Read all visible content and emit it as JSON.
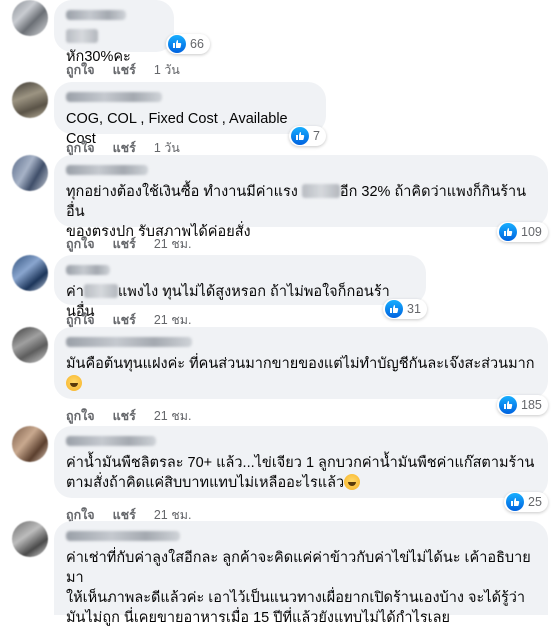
{
  "comments": [
    {
      "text_after_censor": "หัก30%คะ",
      "reactions": "66",
      "actions": {
        "like": "ถูกใจ",
        "reply": "แชร์",
        "time": "1 วัน"
      }
    },
    {
      "text": "COG, COL , Fixed Cost , Available Cost",
      "reactions": "7",
      "actions": {
        "like": "ถูกใจ",
        "reply": "แชร์",
        "time": "1 วัน"
      }
    },
    {
      "text_before_censor": "ทุกอย่างต้องใช้เงินซื้อ ทำงานมีค่าแรง ",
      "text_after_censor": "อีก 32% ถ้าคิดว่าแพงก็กินร้านอื่น",
      "text_line2": "ของตรงปก รับสภาพได้ค่อยสั่ง",
      "reactions": "109",
      "actions": {
        "like": "ถูกใจ",
        "reply": "แชร์",
        "time": "21 ชม."
      }
    },
    {
      "text_before_censor": "ค่า",
      "text_after_censor": "แพงไง ทุนไม่ได้สูงหรอก ถ้าไม่พอใจก็กอนร้านอื่น",
      "reactions": "31",
      "actions": {
        "like": "ถูกใจ",
        "reply": "แชร์",
        "time": "21 ชม."
      }
    },
    {
      "text": "มันคือต้นทุนแฝงค่ะ ที่คนส่วนมากขายของแต่ไม่ทำบัญชีกันละเจ๊งสะส่วนมาก",
      "reactions": "185",
      "actions": {
        "like": "ถูกใจ",
        "reply": "แชร์",
        "time": "21 ชม."
      }
    },
    {
      "text_line1": "ค่าน้ำมันพืชลิตรละ 70+ แล้ว...ไข่เจียว 1 ลูกบวกค่าน้ำมันพืชค่าแก๊สตามร้าน",
      "text_line2": "ตามสั่งถ้าคิดแค่สิบบาทแทบไม่เหลืออะไรแล้ว",
      "reactions": "25",
      "actions": {
        "like": "ถูกใจ",
        "reply": "แชร์",
        "time": "21 ชม."
      }
    },
    {
      "text_line1": "ค่าเช่าที่กับค่าลูงใสอีกละ ลูกค้าจะคิดแค่ค่าข้าวกับค่าไข่ไม่ได้นะ เค้าอธิบายมา",
      "text_line2": "ให้เห็นภาพละดีแล้วค่ะ เอาไว้เป็นแนวทางเผื่อยากเปิดร้านเองบ้าง จะได้รู้ว่า",
      "text_line3": "มันไม่ถูก นี่เคยขายอาหารเมื่อ 15 ปีที่แล้วยังแทบไม่ได้กำไรเลย"
    }
  ],
  "colors": {
    "bubble": "#f0f2f5",
    "meta": "#65676b",
    "like": "#0062df"
  }
}
